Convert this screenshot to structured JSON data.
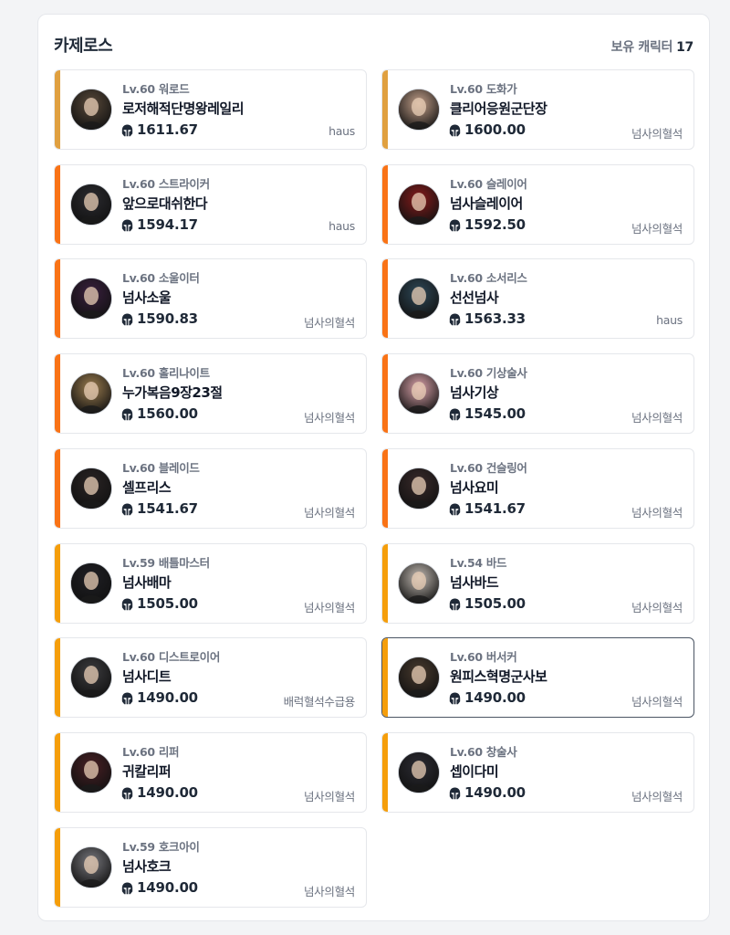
{
  "server_name": "카제로스",
  "owned": {
    "label": "보유 캐릭터",
    "count": "17"
  },
  "colors": {
    "bar_high": "#e0a040",
    "bar_orange": "#f97316",
    "bar_amber": "#f59e0b",
    "text_muted": "#6b7280",
    "selected_border": "#4b5563"
  },
  "characters": [
    {
      "level": "Lv.60",
      "class": "워로드",
      "name": "로저해적단명왕레일리",
      "item_level": "1611.67",
      "guild": "haus",
      "bar_color": "#e0a040",
      "avatar_tone": "#5a4a3a"
    },
    {
      "level": "Lv.60",
      "class": "도화가",
      "name": "클리어응원군단장",
      "item_level": "1600.00",
      "guild": "넘사의혈석",
      "bar_color": "#e0a040",
      "avatar_tone": "#c9a48d"
    },
    {
      "level": "Lv.60",
      "class": "스트라이커",
      "name": "앞으로대쉬한다",
      "item_level": "1594.17",
      "guild": "haus",
      "bar_color": "#f97316",
      "avatar_tone": "#2b2b30"
    },
    {
      "level": "Lv.60",
      "class": "슬레이어",
      "name": "넘사슬레이어",
      "item_level": "1592.50",
      "guild": "넘사의혈석",
      "bar_color": "#f97316",
      "avatar_tone": "#8b1a1a"
    },
    {
      "level": "Lv.60",
      "class": "소울이터",
      "name": "넘사소울",
      "item_level": "1590.83",
      "guild": "넘사의혈석",
      "bar_color": "#f97316",
      "avatar_tone": "#3a1f3f"
    },
    {
      "level": "Lv.60",
      "class": "소서리스",
      "name": "선선넘사",
      "item_level": "1563.33",
      "guild": "haus",
      "bar_color": "#f97316",
      "avatar_tone": "#2e4a5a"
    },
    {
      "level": "Lv.60",
      "class": "홀리나이트",
      "name": "누가복음9장23절",
      "item_level": "1560.00",
      "guild": "넘사의혈석",
      "bar_color": "#f97316",
      "avatar_tone": "#a08050"
    },
    {
      "level": "Lv.60",
      "class": "기상술사",
      "name": "넘사기상",
      "item_level": "1545.00",
      "guild": "넘사의혈석",
      "bar_color": "#f97316",
      "avatar_tone": "#e3a8b0"
    },
    {
      "level": "Lv.60",
      "class": "블레이드",
      "name": "셀프리스",
      "item_level": "1541.67",
      "guild": "넘사의혈석",
      "bar_color": "#f97316",
      "avatar_tone": "#2a2424"
    },
    {
      "level": "Lv.60",
      "class": "건슬링어",
      "name": "넘사요미",
      "item_level": "1541.67",
      "guild": "넘사의혈석",
      "bar_color": "#f97316",
      "avatar_tone": "#3a2a2a"
    },
    {
      "level": "Lv.59",
      "class": "배틀마스터",
      "name": "넘사배마",
      "item_level": "1505.00",
      "guild": "넘사의혈석",
      "bar_color": "#f59e0b",
      "avatar_tone": "#1f1f24"
    },
    {
      "level": "Lv.54",
      "class": "바드",
      "name": "넘사바드",
      "item_level": "1505.00",
      "guild": "넘사의혈석",
      "bar_color": "#f59e0b",
      "avatar_tone": "#c8c0b8"
    },
    {
      "level": "Lv.60",
      "class": "디스트로이어",
      "name": "넘사디트",
      "item_level": "1490.00",
      "guild": "배럭혈석수급용",
      "bar_color": "#f59e0b",
      "avatar_tone": "#3d3d40"
    },
    {
      "level": "Lv.60",
      "class": "버서커",
      "name": "원피스혁명군사보",
      "item_level": "1490.00",
      "guild": "넘사의혈석",
      "bar_color": "#f59e0b",
      "avatar_tone": "#4a3b2e",
      "selected": true
    },
    {
      "level": "Lv.60",
      "class": "리퍼",
      "name": "귀칼리퍼",
      "item_level": "1490.00",
      "guild": "넘사의혈석",
      "bar_color": "#f59e0b",
      "avatar_tone": "#4a1f24"
    },
    {
      "level": "Lv.60",
      "class": "창술사",
      "name": "셉이다미",
      "item_level": "1490.00",
      "guild": "넘사의혈석",
      "bar_color": "#f59e0b",
      "avatar_tone": "#2c2c34"
    },
    {
      "level": "Lv.59",
      "class": "호크아이",
      "name": "넘사호크",
      "item_level": "1490.00",
      "guild": "넘사의혈석",
      "bar_color": "#f59e0b",
      "avatar_tone": "#7a7a80"
    }
  ]
}
